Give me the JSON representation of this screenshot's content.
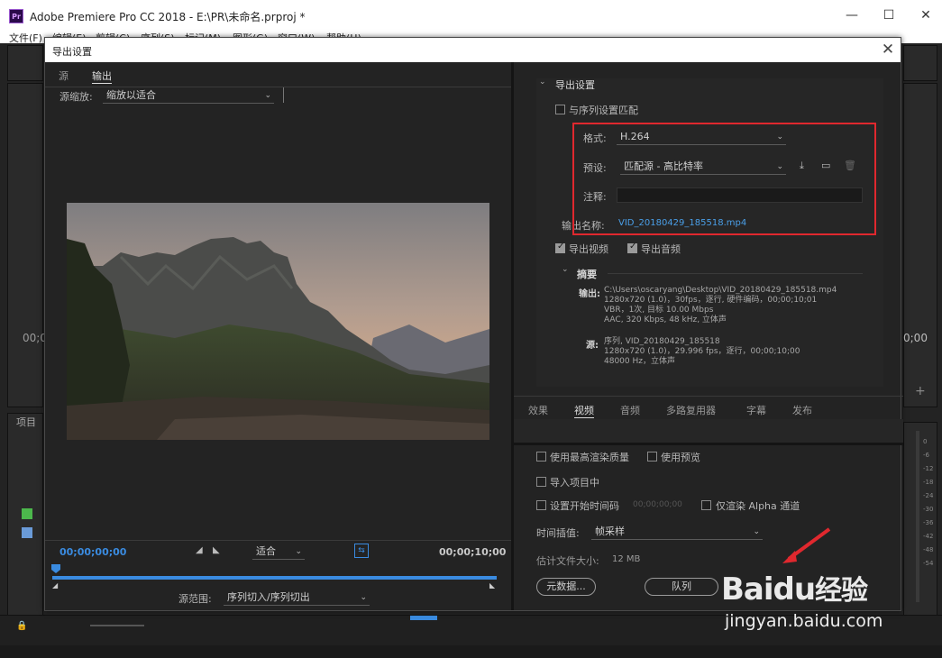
{
  "app": {
    "logo_text": "Pr",
    "title": "Adobe Premiere Pro CC 2018 - E:\\PR\\未命名.prproj *",
    "menu": [
      "文件(F)",
      "编辑(E)",
      "剪辑(C)",
      "序列(S)",
      "标记(M)",
      "图形(G)",
      "窗口(W)",
      "帮助(H)"
    ],
    "bg_timecode_left": "00;0",
    "bg_timecode_right": "0;00",
    "bg_project_tab": "项目"
  },
  "dialog": {
    "title": "导出设置",
    "close_icon": "close-icon",
    "source_tabs": [
      {
        "label": "源",
        "active": false
      },
      {
        "label": "输出",
        "active": true
      }
    ],
    "source_scale_label": "源缩放:",
    "source_scale_value": "缩放以适合",
    "preview": {
      "timecode_start": "00;00;00;00",
      "timecode_end": "00;00;10;00",
      "fit_value": "适合",
      "source_range_label": "源范围:",
      "source_range_value": "序列切入/序列切出",
      "playhead_fraction": 0
    },
    "export_settings": {
      "section_title": "导出设置",
      "match_sequence_label": "与序列设置匹配",
      "match_sequence_checked": false,
      "format_label": "格式:",
      "format_value": "H.264",
      "preset_label": "预设:",
      "preset_value": "匹配源 - 高比特率",
      "comment_label": "注释:",
      "comment_value": "",
      "output_name_label": "输出名称:",
      "output_name_value": "VID_20180429_185518.mp4",
      "export_video_label": "导出视频",
      "export_video_checked": true,
      "export_audio_label": "导出音频",
      "export_audio_checked": true
    },
    "summary": {
      "title": "摘要",
      "output_label": "输出:",
      "output_lines": [
        "C:\\Users\\oscaryang\\Desktop\\VID_20180429_185518.mp4",
        "1280x720 (1.0)，30fps，逐行, 硬件编码，00;00;10;01",
        "VBR，1次, 目标 10.00 Mbps",
        "AAC, 320 Kbps, 48  kHz, 立体声"
      ],
      "source_label": "源:",
      "source_lines": [
        "序列, VID_20180429_185518",
        "1280x720 (1.0)，29.996 fps，逐行，00;00;10;00",
        "48000 Hz，立体声"
      ]
    },
    "settings_tabs": [
      {
        "label": "效果",
        "active": false
      },
      {
        "label": "视频",
        "active": true
      },
      {
        "label": "音频",
        "active": false
      },
      {
        "label": "多路复用器",
        "active": false
      },
      {
        "label": "字幕",
        "active": false
      },
      {
        "label": "发布",
        "active": false
      }
    ],
    "bottom": {
      "max_render_quality_label": "使用最高渲染质量",
      "use_previews_label": "使用预览",
      "import_into_project_label": "导入项目中",
      "set_start_timecode_label": "设置开始时间码",
      "start_timecode_value": "00;00;00;00",
      "render_alpha_label": "仅渲染 Alpha 通道",
      "time_interpolation_label": "时间插值:",
      "time_interpolation_value": "帧采样",
      "file_size_label": "估计文件大小:",
      "file_size_value": "12 MB",
      "metadata_button": "元数据...",
      "queue_button": "队列"
    }
  },
  "right_meter_ticks": [
    "0",
    "-6",
    "-12",
    "-18",
    "-24",
    "-30",
    "-36",
    "-42",
    "-48",
    "-54"
  ],
  "watermark": {
    "brand": "Baidu",
    "brand_suffix": "经验",
    "url": "jingyan.baidu.com"
  },
  "colors": {
    "accent_blue": "#3a8be0",
    "highlight_red": "#e0282e",
    "link_blue": "#4a9fe8"
  }
}
